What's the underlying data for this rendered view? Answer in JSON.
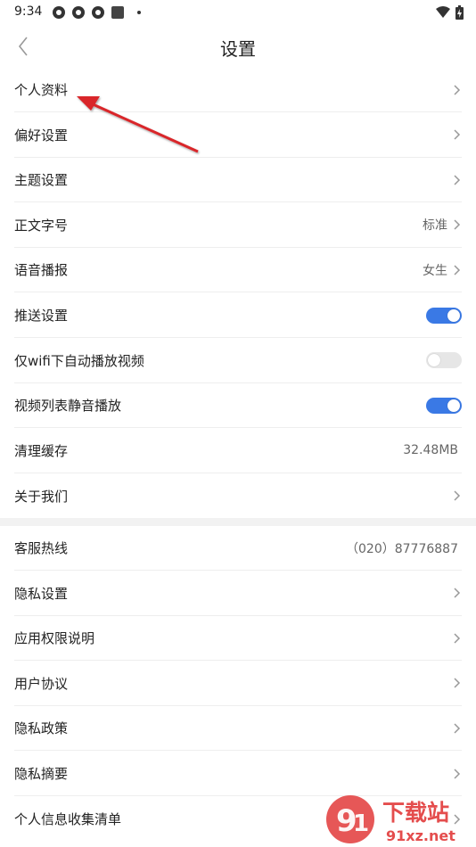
{
  "status_bar": {
    "time": "9:34"
  },
  "header": {
    "title": "设置"
  },
  "section1": [
    {
      "label": "个人资料",
      "value": "",
      "control": "chevron"
    },
    {
      "label": "偏好设置",
      "value": "",
      "control": "chevron"
    },
    {
      "label": "主题设置",
      "value": "",
      "control": "chevron"
    },
    {
      "label": "正文字号",
      "value": "标准",
      "control": "chevron"
    },
    {
      "label": "语音播报",
      "value": "女生",
      "control": "chevron"
    },
    {
      "label": "推送设置",
      "value": "",
      "control": "toggle",
      "on": true
    },
    {
      "label": "仅wifi下自动播放视频",
      "value": "",
      "control": "toggle",
      "on": false
    },
    {
      "label": "视频列表静音播放",
      "value": "",
      "control": "toggle",
      "on": true
    },
    {
      "label": "清理缓存",
      "value": "32.48MB",
      "control": "none"
    },
    {
      "label": "关于我们",
      "value": "",
      "control": "chevron"
    }
  ],
  "section2": [
    {
      "label": "客服热线",
      "value": "（020）87776887",
      "control": "none"
    },
    {
      "label": "隐私设置",
      "value": "",
      "control": "chevron"
    },
    {
      "label": "应用权限说明",
      "value": "",
      "control": "chevron"
    },
    {
      "label": "用户协议",
      "value": "",
      "control": "chevron"
    },
    {
      "label": "隐私政策",
      "value": "",
      "control": "chevron"
    },
    {
      "label": "隐私摘要",
      "value": "",
      "control": "chevron"
    },
    {
      "label": "个人信息收集清单",
      "value": "",
      "control": "chevron"
    }
  ],
  "watermark": {
    "text_cn": "下载站",
    "text_en": "91xz.net"
  },
  "colors": {
    "accent": "#3a79e5",
    "annotation_arrow": "#d9262a"
  }
}
